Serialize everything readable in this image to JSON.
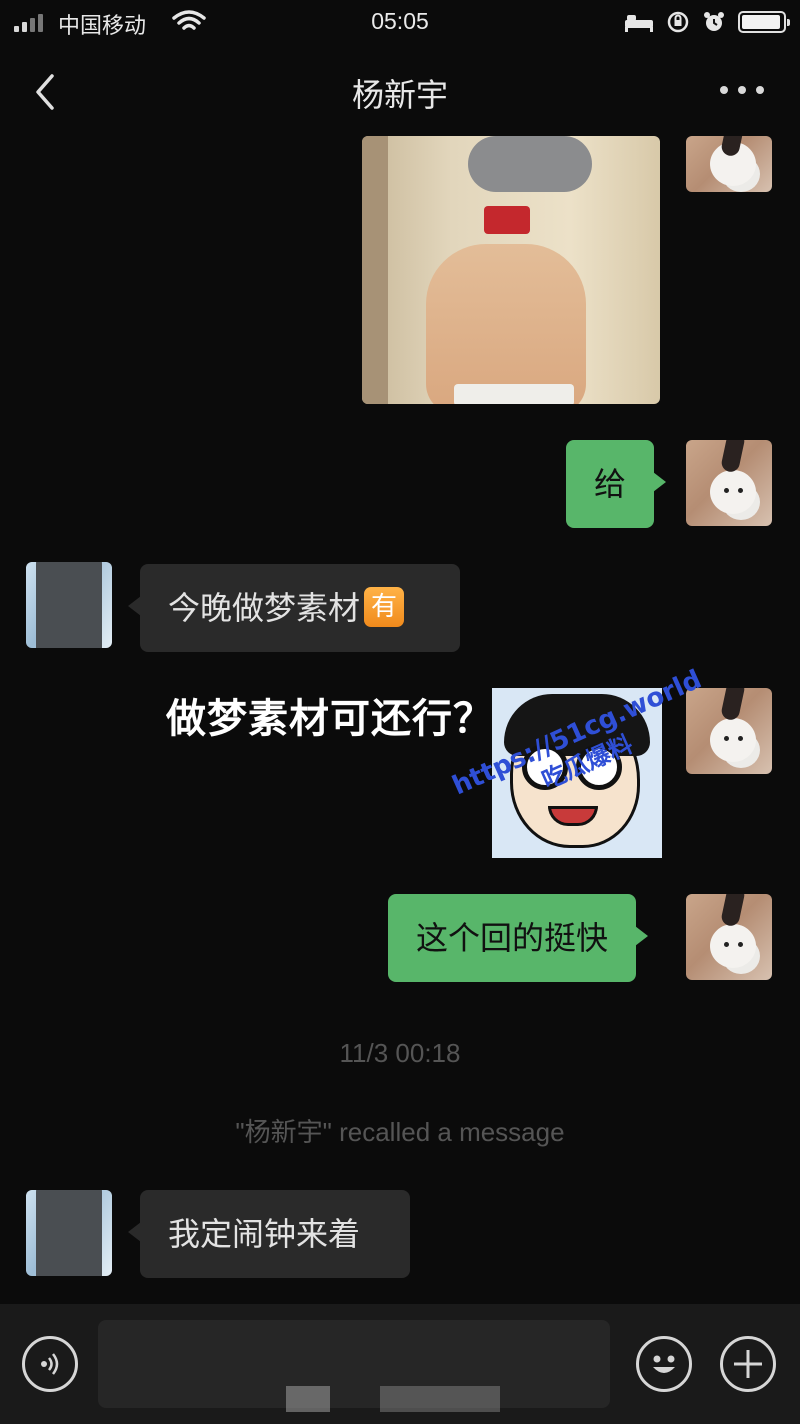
{
  "status_bar": {
    "carrier": "中国移动",
    "time": "05:05",
    "icons": [
      "signal-icon",
      "wifi-icon",
      "bed-icon",
      "orientation-lock-icon",
      "alarm-icon",
      "battery-icon"
    ]
  },
  "header": {
    "title": "杨新宇",
    "back_icon": "chevron-left-icon",
    "more_icon": "more-dots-icon"
  },
  "messages": [
    {
      "sender": "me",
      "type": "image",
      "content": "selfie-photo"
    },
    {
      "sender": "me",
      "type": "text",
      "text": "给"
    },
    {
      "sender": "them",
      "type": "text",
      "text": "今晚做梦素材",
      "emoji_char": "有"
    },
    {
      "sender": "me",
      "type": "sticker",
      "caption": "做梦素材可还行？",
      "watermark_url": "https://51cg.world",
      "watermark_sub": "吃瓜爆料"
    },
    {
      "sender": "me",
      "type": "text",
      "text": "这个回的挺快"
    },
    {
      "type": "timestamp",
      "text": "11/3 00:18"
    },
    {
      "type": "system",
      "text": "\"杨新宇\" recalled a message"
    },
    {
      "sender": "them",
      "type": "text",
      "text": "我定闹钟来着"
    }
  ],
  "input_bar": {
    "voice_icon": "voice-icon",
    "emoji_icon": "emoji-smile-icon",
    "add_icon": "plus-icon"
  },
  "colors": {
    "background": "#0b0b0b",
    "my_bubble": "#58b66a",
    "their_bubble": "#2a2a2a",
    "system_text": "#555555"
  }
}
